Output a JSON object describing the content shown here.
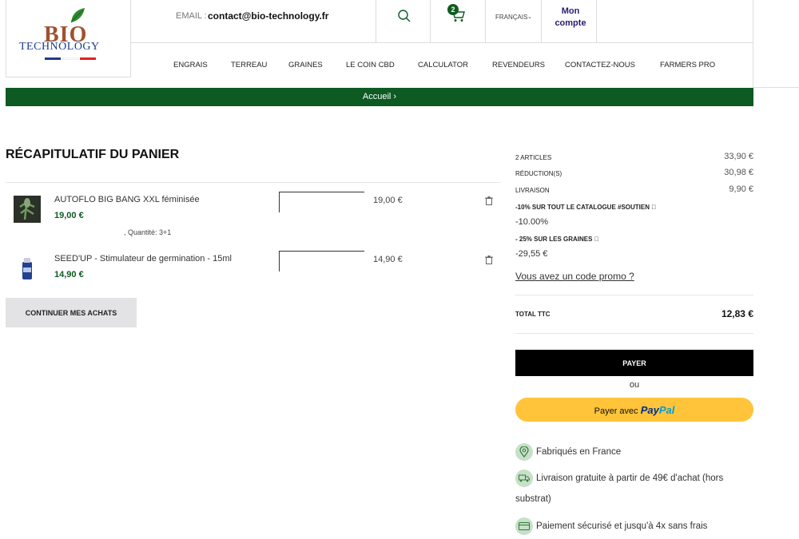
{
  "header": {
    "logo_line1": "BIO",
    "logo_line2": "TECHNOLOGY",
    "email_label": "EMAIL :",
    "email_value": "contact@bio-technology.fr",
    "cart_count": "2",
    "language": "FRANÇAIS",
    "account_label": "Mon compte",
    "brand_green": "#0d5a22"
  },
  "nav": {
    "items": [
      "ENGRAIS",
      "TERREAU",
      "GRAINES",
      "LE COIN CBD",
      "CALCULATOR",
      "REVENDEURS",
      "CONTACTEZ-NOUS",
      "FARMERS PRO"
    ]
  },
  "breadcrumb": "Accueil ›",
  "cart": {
    "title": "RÉCAPITULATIF DU PANIER",
    "items": [
      {
        "name": "AUTOFLO BIG BANG XXL féminisée",
        "price": "19,00 €",
        "total": "19,00 €",
        "meta": ", Quantité: 3+1"
      },
      {
        "name": "SEED'UP - Stimulateur de germination - 15ml",
        "price": "14,90 €",
        "total": "14,90 €",
        "meta": ""
      }
    ],
    "continue_label": "CONTINUER MES ACHATS"
  },
  "summary": {
    "articles_label": "2 articles",
    "articles_value": "33,90 €",
    "reduction_label": "Réduction(s)",
    "reduction_value": "30,98 €",
    "shipping_label": "Livraison",
    "shipping_value": "9,90 €",
    "promo1_title": "-10% SUR TOUT LE CATALOGUE #SOUTIEN",
    "promo1_value": "-10.00%",
    "promo2_title": "- 25% SUR LES GRAINES",
    "promo2_value": "-29,55 €",
    "promo_link": "Vous avez un code promo ?",
    "total_label": "TOTAL TTC",
    "total_value": "12,83 €",
    "pay_label": "PAYER",
    "or_label": "ou",
    "paypal_prefix": "Payer avec",
    "paypal_brand1": "Pay",
    "paypal_brand2": "Pal"
  },
  "reassurance": {
    "made_in": "Fabriqués en France",
    "free_shipping": "Livraison gratuite à partir de 49€ d'achat (hors substrat)",
    "secure_payment": "Paiement sécurisé et jusqu'à 4x sans frais"
  }
}
